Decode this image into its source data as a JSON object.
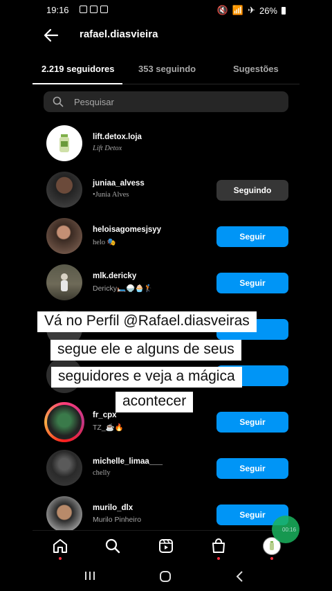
{
  "status": {
    "time": "19:16",
    "battery": "26%"
  },
  "header": {
    "title": "rafael.diasvieira"
  },
  "tabs": [
    {
      "label": "2.219 seguidores",
      "active": true
    },
    {
      "label": "353 seguindo",
      "active": false
    },
    {
      "label": "Sugestões",
      "active": false
    }
  ],
  "search": {
    "placeholder": "Pesquisar"
  },
  "users": [
    {
      "username": "lift.detox.loja",
      "display": "Lift Detox",
      "button": ""
    },
    {
      "username": "juniaa_alvess",
      "display": "•Junia Alves",
      "button": "Seguindo"
    },
    {
      "username": "heloisagomesjsyy",
      "display": "helo 🎭",
      "button": "Seguir"
    },
    {
      "username": "mlk.dericky",
      "display": "Dericky🛏️🍚🧁🏌",
      "button": "Seguir"
    },
    {
      "username": "",
      "display": "",
      "button": ""
    },
    {
      "username": "fr_cpx",
      "display": "TZ_☕🔥",
      "button": "Seguir"
    },
    {
      "username": "michelle_limaa___",
      "display": "chelly",
      "button": "Seguir"
    },
    {
      "username": "murilo_dlx",
      "display": "Murilo Pinheiro",
      "button": "Seguir"
    }
  ],
  "caption": {
    "lines": [
      "Vá no Perfil @Rafael.diasveiras",
      "segue ele e alguns de seus",
      "seguidores e veja a mágica",
      "acontecer"
    ]
  },
  "fab": {
    "label": "00:16"
  },
  "colors": {
    "follow": "#0095f6",
    "following": "#363636",
    "background": "#000000"
  }
}
